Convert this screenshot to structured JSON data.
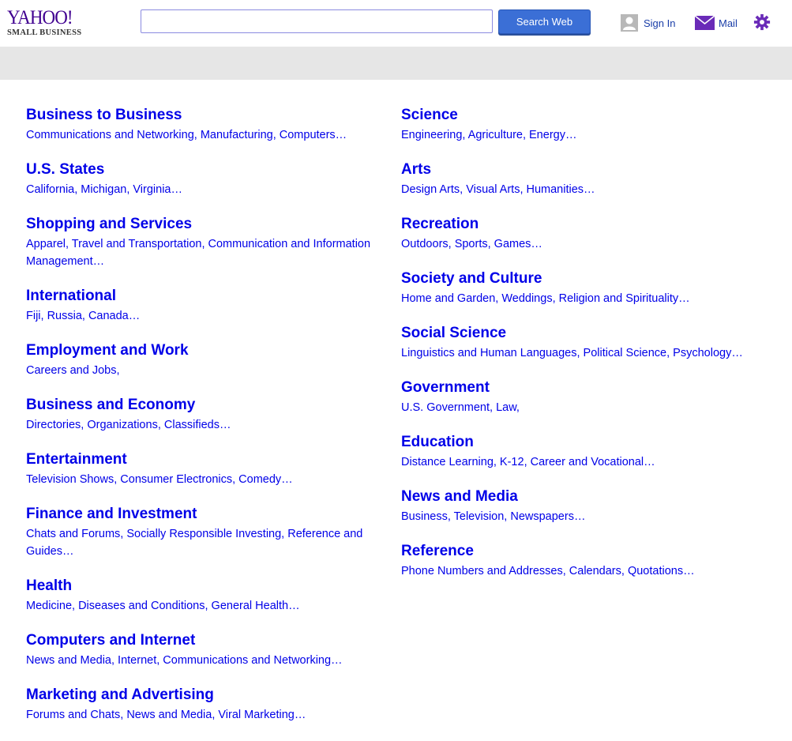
{
  "header": {
    "logo_main": "YAHOO!",
    "logo_sub": "SMALL BUSINESS",
    "search_value": "",
    "search_button": "Search Web",
    "signin_label": "Sign In",
    "mail_label": "Mail",
    "icons": [
      "user-icon",
      "mail-icon",
      "gear-icon"
    ],
    "accent_color": "#400090"
  },
  "left_categories": [
    {
      "title": "Business to Business",
      "subtitle": "Communications and Networking, Manufacturing, Computers…"
    },
    {
      "title": "U.S. States",
      "subtitle": "California, Michigan, Virginia…"
    },
    {
      "title": "Shopping and Services",
      "subtitle": "Apparel, Travel and Transportation, Communication and Information Management…"
    },
    {
      "title": "International",
      "subtitle": "Fiji, Russia, Canada…"
    },
    {
      "title": "Employment and Work",
      "subtitle": "Careers and Jobs,"
    },
    {
      "title": "Business and Economy",
      "subtitle": "Directories, Organizations, Classifieds…"
    },
    {
      "title": "Entertainment",
      "subtitle": "Television Shows, Consumer Electronics, Comedy…"
    },
    {
      "title": "Finance and Investment",
      "subtitle": "Chats and Forums, Socially Responsible Investing, Reference and Guides…"
    },
    {
      "title": "Health",
      "subtitle": "Medicine, Diseases and Conditions, General Health…"
    },
    {
      "title": "Computers and Internet",
      "subtitle": "News and Media, Internet, Communications and Networking…"
    },
    {
      "title": "Marketing and Advertising",
      "subtitle": "Forums and Chats, News and Media, Viral Marketing…"
    }
  ],
  "right_categories": [
    {
      "title": "Science",
      "subtitle": "Engineering, Agriculture, Energy…"
    },
    {
      "title": "Arts",
      "subtitle": "Design Arts, Visual Arts, Humanities…"
    },
    {
      "title": "Recreation",
      "subtitle": "Outdoors, Sports, Games…"
    },
    {
      "title": "Society and Culture",
      "subtitle": "Home and Garden, Weddings, Religion and Spirituality…"
    },
    {
      "title": "Social Science",
      "subtitle": "Linguistics and Human Languages, Political Science, Psychology…"
    },
    {
      "title": "Government",
      "subtitle": "U.S. Government, Law,"
    },
    {
      "title": "Education",
      "subtitle": "Distance Learning, K-12, Career and Vocational…"
    },
    {
      "title": "News and Media",
      "subtitle": "Business, Television, Newspapers…"
    },
    {
      "title": "Reference",
      "subtitle": "Phone Numbers and Addresses, Calendars, Quotations…"
    }
  ]
}
